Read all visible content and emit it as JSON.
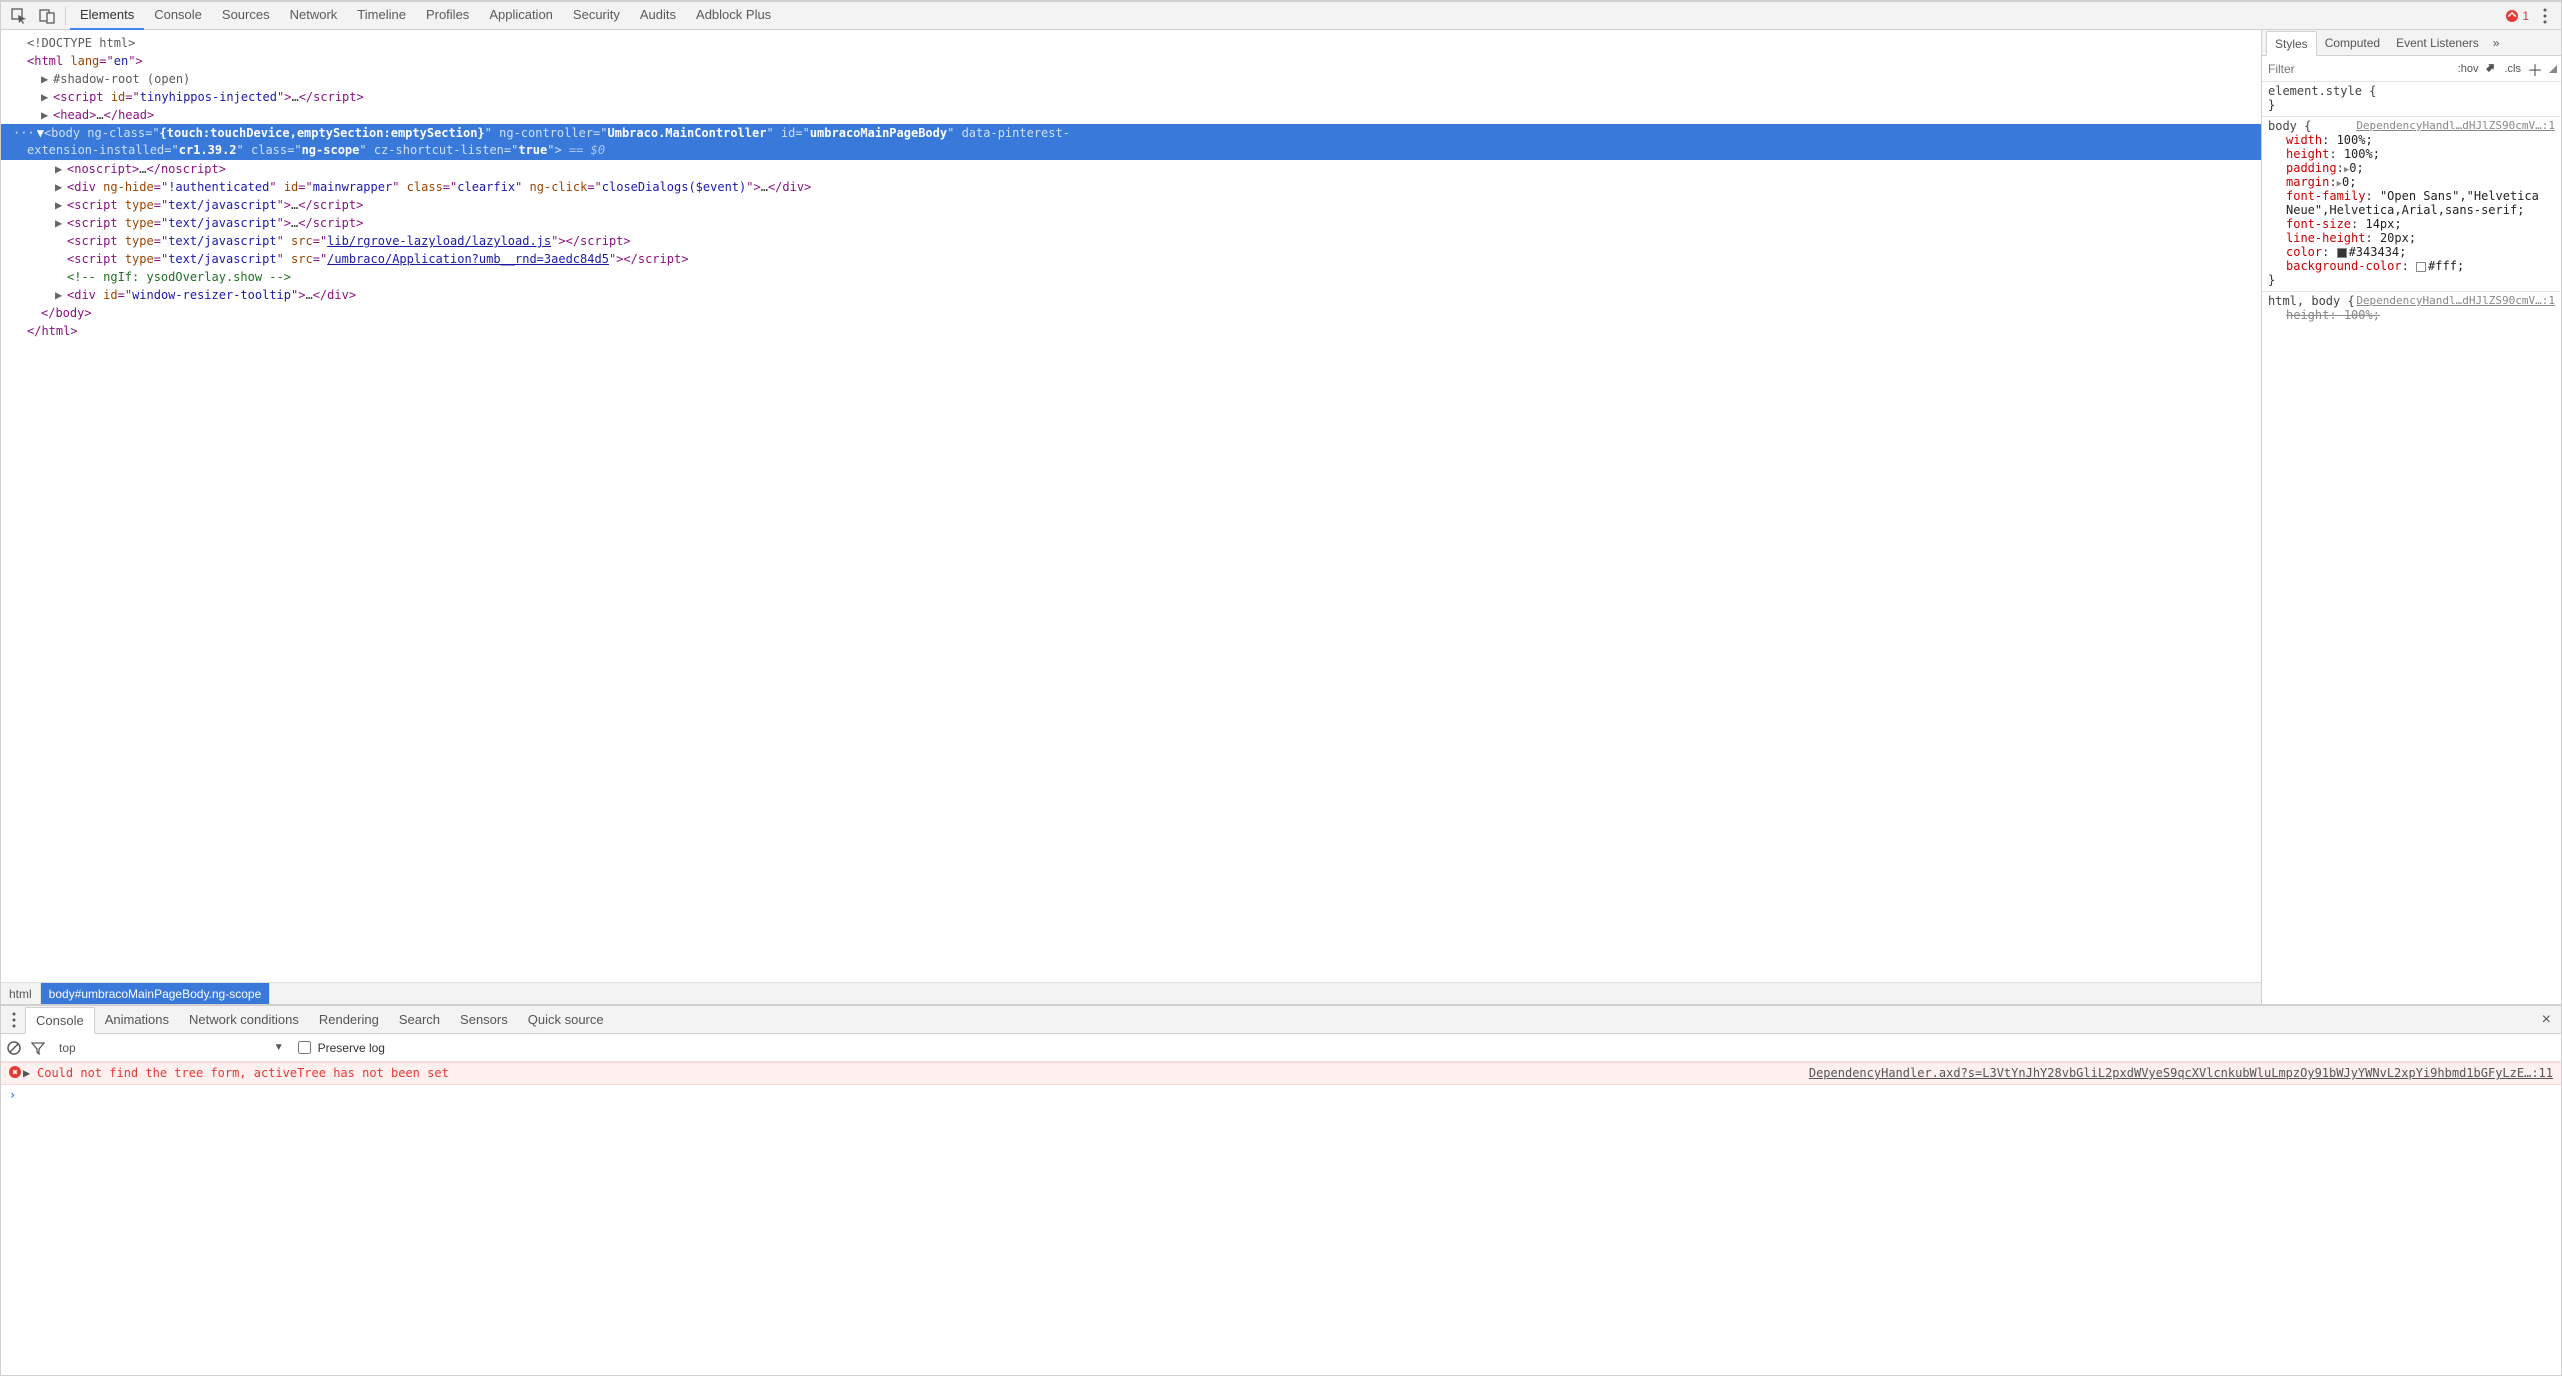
{
  "toolbar": {
    "main_tabs": [
      "Elements",
      "Console",
      "Sources",
      "Network",
      "Timeline",
      "Profiles",
      "Application",
      "Security",
      "Audits",
      "Adblock Plus"
    ],
    "active_main_tab": 0,
    "error_count": "1"
  },
  "dom": {
    "l1": "<!DOCTYPE html>",
    "l2": {
      "open": "<",
      "tag": "html",
      "attrs": [
        {
          "n": "lang",
          "v": "en"
        }
      ],
      "close": ">"
    },
    "l3": "#shadow-root (open)",
    "l4": {
      "tag": "script",
      "attrs": [
        {
          "n": "id",
          "v": "tinyhippos-injected"
        }
      ],
      "ell": "…"
    },
    "l5": {
      "tag": "head",
      "ell": "…"
    },
    "body_sel": {
      "pre": "···",
      "tag": "body",
      "attrs_line1": [
        {
          "n": "ng-class",
          "v": "{touch:touchDevice,emptySection:emptySection}",
          "bold": true
        },
        {
          "n": "ng-controller",
          "v": "Umbraco.MainController",
          "bold": true
        },
        {
          "n": "id",
          "v": "umbracoMainPageBody",
          "bold": true
        },
        {
          "n": "data-pinterest-",
          "cont": true
        }
      ],
      "attrs_line2": [
        {
          "n": "extension-installed",
          "v": "cr1.39.2",
          "bold": true,
          "nocont": true
        },
        {
          "n": "class",
          "v": "ng-scope",
          "bold": true
        },
        {
          "n": "cz-shortcut-listen",
          "v": "true",
          "bold": true
        }
      ],
      "eq0": " == $0"
    },
    "c1": {
      "tag": "noscript",
      "ell": "…"
    },
    "c2": {
      "tag": "div",
      "attrs": [
        {
          "n": "ng-hide",
          "v": "!authenticated"
        },
        {
          "n": "id",
          "v": "mainwrapper"
        },
        {
          "n": "class",
          "v": "clearfix"
        },
        {
          "n": "ng-click",
          "v": "closeDialogs($event)"
        }
      ],
      "ell": "…"
    },
    "c3": {
      "tag": "script",
      "attrs": [
        {
          "n": "type",
          "v": "text/javascript"
        }
      ],
      "ell": "…"
    },
    "c4": {
      "tag": "script",
      "attrs": [
        {
          "n": "type",
          "v": "text/javascript"
        }
      ],
      "ell": "…"
    },
    "c5": {
      "tag": "script",
      "attrs": [
        {
          "n": "type",
          "v": "text/javascript"
        },
        {
          "n": "src",
          "v": "lib/rgrove-lazyload/lazyload.js",
          "link": true
        }
      ]
    },
    "c6": {
      "tag": "script",
      "attrs": [
        {
          "n": "type",
          "v": "text/javascript"
        },
        {
          "n": "src",
          "v": "/umbraco/Application?umb__rnd=3aedc84d5",
          "link": true
        }
      ]
    },
    "c7_comment": "<!-- ngIf: ysodOverlay.show -->",
    "c8": {
      "tag": "div",
      "attrs": [
        {
          "n": "id",
          "v": "window-resizer-tooltip"
        }
      ],
      "ell": "…"
    },
    "close_body": "</body>",
    "close_html": "</html>"
  },
  "breadcrumbs": [
    "html",
    "body#umbracoMainPageBody.ng-scope"
  ],
  "breadcrumb_active": 1,
  "styles": {
    "tabs": [
      "Styles",
      "Computed",
      "Event Listeners"
    ],
    "active_tab": 0,
    "filter_placeholder": "Filter",
    "hov": ":hov",
    "cls": ".cls",
    "rule_element": {
      "selector": "element.style {",
      "close": "}"
    },
    "rule_body": {
      "selector": "body {",
      "source": "DependencyHandl…dHJlZS90cmV…:1",
      "props": [
        {
          "n": "width",
          "v": "100%;"
        },
        {
          "n": "height",
          "v": "100%;"
        },
        {
          "n": "padding",
          "v": "0;",
          "tri": true
        },
        {
          "n": "margin",
          "v": "0;",
          "tri": true
        },
        {
          "n": "font-family",
          "v": "\"Open Sans\",\"Helvetica Neue\",Helvetica,Arial,sans-serif;"
        },
        {
          "n": "font-size",
          "v": "14px;"
        },
        {
          "n": "line-height",
          "v": "20px;"
        },
        {
          "n": "color",
          "v": "#343434;",
          "swatch": "#343434"
        },
        {
          "n": "background-color",
          "v": "#fff;",
          "swatch": "#ffffff"
        }
      ],
      "close": "}"
    },
    "rule_html": {
      "selector": "html, body {",
      "source": "DependencyHandl…dHJlZS90cmV…:1",
      "props": [
        {
          "n": "height",
          "v": "100%;",
          "strike": true
        }
      ]
    }
  },
  "drawer": {
    "tabs": [
      "Console",
      "Animations",
      "Network conditions",
      "Rendering",
      "Search",
      "Sensors",
      "Quick source"
    ],
    "active_tab": 0,
    "context": "top",
    "preserve_log": "Preserve log",
    "error_msg": "Could not find the tree form, activeTree has not been set",
    "error_src": "DependencyHandler.axd?s=L3VtYnJhY28vbGliL2pxdWVyeS9qcXVlcnkubWluLmpzOy91bWJyYWNvL2xpYi9hbmd1bGFyLzE…:11"
  }
}
